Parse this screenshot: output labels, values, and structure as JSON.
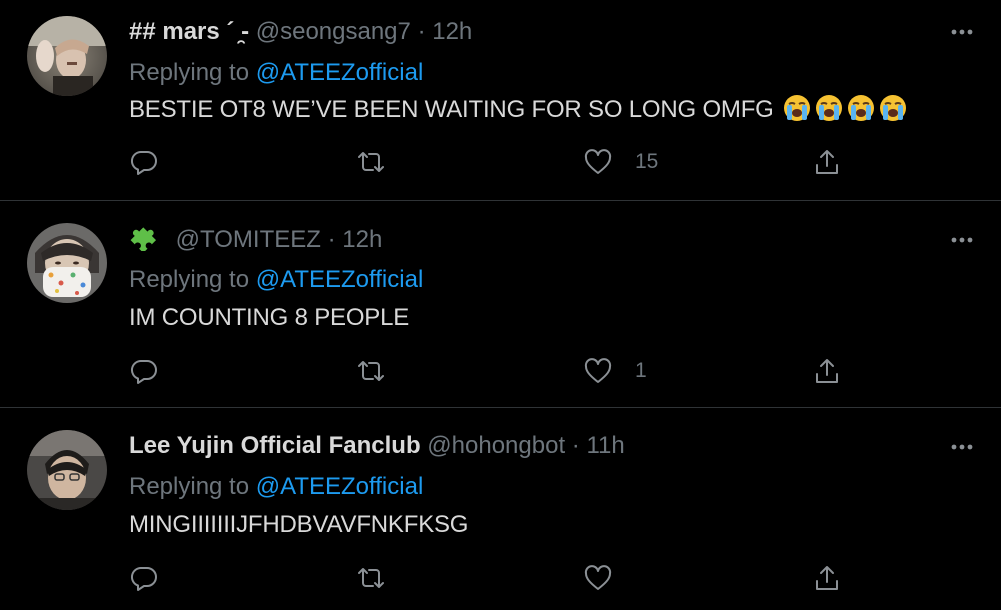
{
  "colors": {
    "background": "#000000",
    "text": "#d9d9d9",
    "muted": "#6e767d",
    "link": "#1d9bf0",
    "divider": "#2f3336"
  },
  "tweets": [
    {
      "display_name": "## mars ´ ̯-",
      "handle": "@seongsang7",
      "separator": "·",
      "time": "12h",
      "replying_prefix": "Replying to",
      "replying_to": "@ATEEZofficial",
      "text": "BESTIE OT8 WE’VE BEEN WAITING FOR SO LONG OMFG",
      "emojis": [
        "loudly-crying-face",
        "loudly-crying-face",
        "loudly-crying-face",
        "loudly-crying-face"
      ],
      "likes": "15"
    },
    {
      "display_name_icon": "puzzle-piece-icon",
      "handle": "@TOMITEEZ",
      "separator": "·",
      "time": "12h",
      "replying_prefix": "Replying to",
      "replying_to": "@ATEEZofficial",
      "text": "IM COUNTING 8 PEOPLE",
      "likes": "1"
    },
    {
      "display_name": "Lee Yujin Official Fanclub",
      "handle": "@hohongbot",
      "separator": "·",
      "time": "11h",
      "replying_prefix": "Replying to",
      "replying_to": "@ATEEZofficial",
      "text": "MINGIIIIIIIJFHDBVAVFNKFKSG",
      "likes": ""
    }
  ],
  "icons": {
    "reply": "reply-icon",
    "retweet": "retweet-icon",
    "like": "heart-icon",
    "share": "share-icon",
    "more": "more-icon"
  }
}
